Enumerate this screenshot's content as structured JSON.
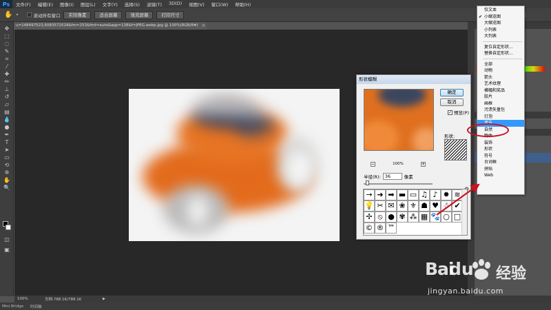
{
  "app": {
    "logo": "Ps",
    "menu": [
      "文件(F)",
      "编辑(E)",
      "图像(I)",
      "图层(L)",
      "文字(Y)",
      "选择(S)",
      "滤镜(T)",
      "3D(D)",
      "视图(V)",
      "窗口(W)",
      "帮助(H)"
    ]
  },
  "options_bar": {
    "scroll_all_label": "滚动所有窗口",
    "buttons": [
      "实际像素",
      "适合屏幕",
      "填充屏幕",
      "打印尺寸"
    ],
    "right_text": "必能"
  },
  "document": {
    "tab_title": "u=148497523,6083572018&fm=253&fmt=auto&app=138&f=JPEG.webp.jpg @ 100%(RGB/8#)",
    "close": "×"
  },
  "status": {
    "zoom": "100%",
    "doc_info": "文档:788.1K/788.1K",
    "arrow": "▶"
  },
  "bottom_tabs": [
    "Mini Bridge",
    "时间轴"
  ],
  "dialog": {
    "title": "形状模糊",
    "ok": "确定",
    "cancel": "取消",
    "preview_label": "预览(P)",
    "preview_checked": true,
    "zoom_minus": "−",
    "zoom_value": "100%",
    "zoom_plus": "+",
    "radius_label": "半径(R):",
    "radius_value": "36",
    "radius_unit": "像素",
    "shape_label": "形状:",
    "shapes": [
      "→",
      "➜",
      "➡",
      "▬",
      "▭",
      "♫",
      "♪",
      "✹",
      "≋",
      "💡",
      "✂",
      "✉",
      "❀",
      "⚜",
      "☗",
      "♥",
      "☃",
      "✔",
      "✢",
      "⦸",
      "●",
      "✾",
      "⁂",
      "▦",
      "🐾",
      "○",
      "□",
      "©",
      "®",
      "™"
    ]
  },
  "dropdown": {
    "items": [
      {
        "label": "仅文本",
        "checked": false
      },
      {
        "label": "小缩览图",
        "checked": true
      },
      {
        "label": "大缩览图",
        "checked": false
      },
      {
        "label": "小列表",
        "checked": false
      },
      {
        "label": "大列表",
        "checked": false
      },
      {
        "sep": true
      },
      {
        "label": "复位自定形状...",
        "checked": false
      },
      {
        "label": "替换自定形状...",
        "checked": false
      },
      {
        "sep": true
      },
      {
        "label": "全部",
        "checked": false
      },
      {
        "label": "动物",
        "checked": false
      },
      {
        "label": "箭头",
        "checked": false
      },
      {
        "label": "艺术纹理",
        "checked": false
      },
      {
        "label": "横幅和奖品",
        "checked": false
      },
      {
        "label": "胶片",
        "checked": false
      },
      {
        "label": "画框",
        "checked": false
      },
      {
        "label": "污渍矢量包",
        "checked": false
      },
      {
        "label": "灯泡",
        "checked": false
      },
      {
        "label": "音乐",
        "checked": false,
        "selected": true
      },
      {
        "label": "自然",
        "checked": false
      },
      {
        "label": "物体",
        "checked": false
      },
      {
        "label": "装饰",
        "checked": false
      },
      {
        "label": "形状",
        "checked": false
      },
      {
        "label": "符号",
        "checked": false
      },
      {
        "label": "台词框",
        "checked": false
      },
      {
        "label": "拼贴",
        "checked": false
      },
      {
        "label": "Web",
        "checked": false
      }
    ]
  },
  "watermark": {
    "brand": "Bai",
    "brand2": "du",
    "cn": "经验",
    "url": "jingyan.baidu.com"
  },
  "colors": {
    "accent_red": "#cc1122",
    "selection": "#3399ff",
    "car_orange": "#e06a1c"
  }
}
